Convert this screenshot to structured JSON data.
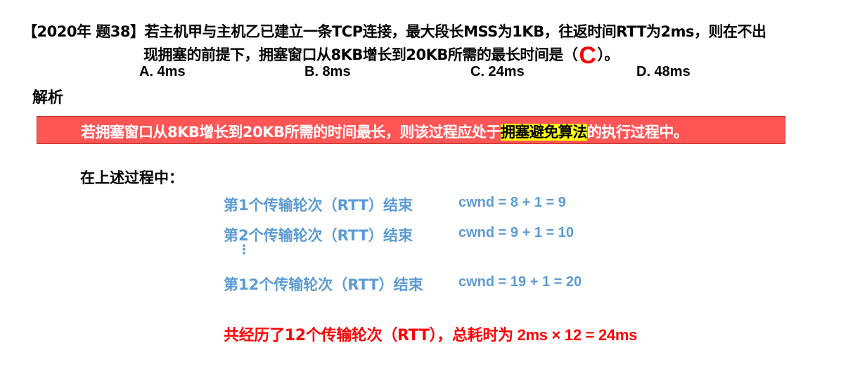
{
  "question": {
    "line1": "【2020年 题38】若主机甲与主机乙已建立一条TCP连接，最大段长MSS为1KB，往返时间RTT为2ms，则在不出",
    "line2_before": "现拥塞的前提下，拥塞窗口从8KB增长到20KB所需的最长时间是（",
    "answer": "C",
    "line2_after": "）。",
    "answer_color": "#ff0000"
  },
  "options": [
    {
      "label": "A. 4ms"
    },
    {
      "label": "B. 8ms"
    },
    {
      "label": "C. 24ms"
    },
    {
      "label": "D. 48ms"
    }
  ],
  "analysis": {
    "heading": "解析",
    "banner_before": "若拥塞窗口从8KB增长到20KB所需的时间最长，则该过程应处于",
    "banner_highlight": "拥塞避免算法",
    "banner_after": "的执行过程中。",
    "banner_color": "#ff5555",
    "highlight_color": "#ffff00"
  },
  "process": {
    "heading": "在上述过程中：",
    "rounds": [
      {
        "label": "第1个传输轮次（RTT）结束",
        "calc": "cwnd = 8 + 1 = 9"
      },
      {
        "label": "第2个传输轮次（RTT）结束",
        "calc": "cwnd = 9 + 1 = 10"
      },
      {
        "label": "第12个传输轮次（RTT）结束",
        "calc": "cwnd = 19 + 1 = 20"
      }
    ],
    "ellipsis": "⋮",
    "text_color": "#5b9bd5"
  },
  "summary": {
    "text": "共经历了12个传输轮次（RTT），总耗时为",
    "calc": " 2ms × 12 = 24ms",
    "color": "#ff0000"
  }
}
